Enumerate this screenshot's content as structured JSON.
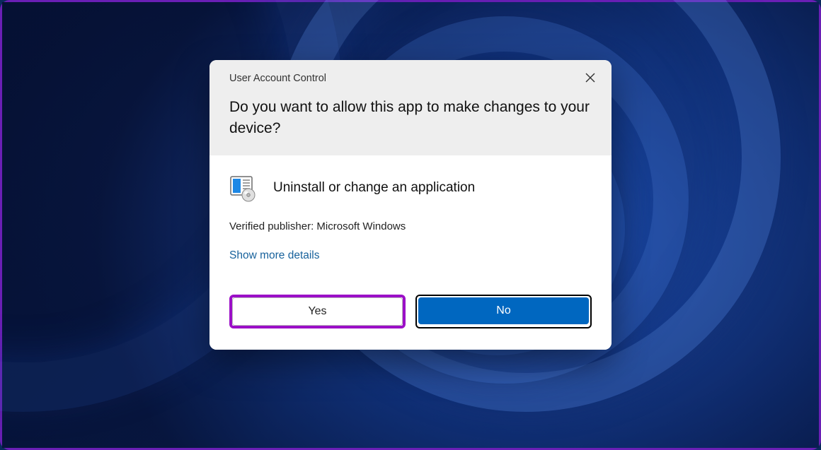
{
  "dialog": {
    "title": "User Account Control",
    "question": "Do you want to allow this app to make changes to your device?",
    "app_name": "Uninstall or change an application",
    "publisher": "Verified publisher: Microsoft Windows",
    "more_details": "Show more details",
    "yes_label": "Yes",
    "no_label": "No"
  }
}
